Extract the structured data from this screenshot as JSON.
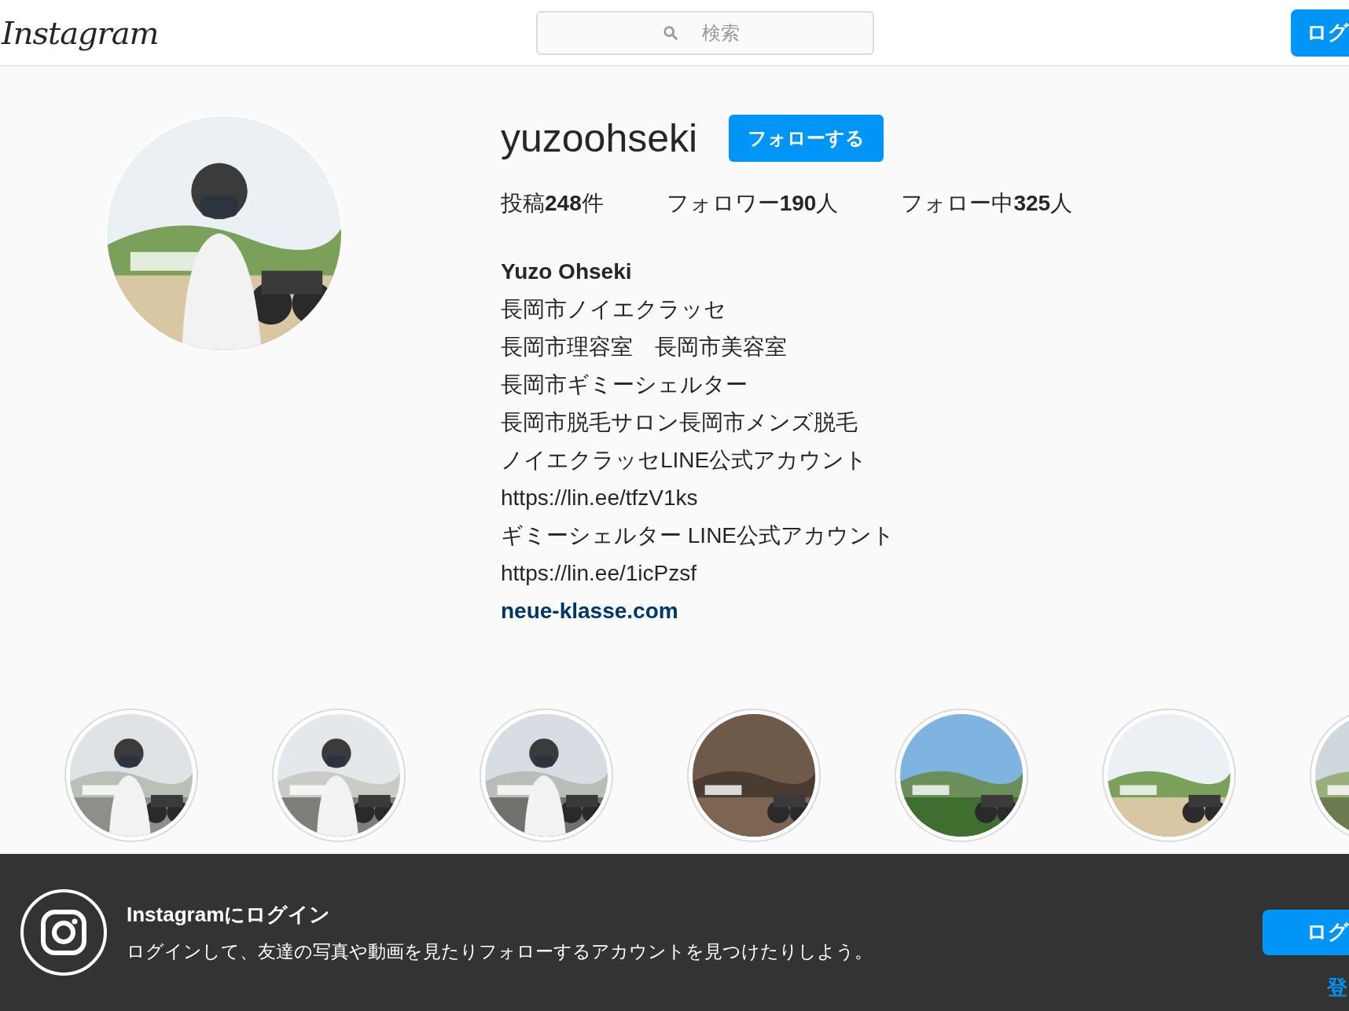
{
  "header": {
    "logo": "Instagram",
    "search": {
      "placeholder": "検索"
    },
    "login_button": "ログ"
  },
  "profile": {
    "username": "yuzoohseki",
    "follow_button": "フォローする",
    "stats": [
      "投稿**248**件",
      "フォロワー**190**人",
      "フォロー中**325**人"
    ],
    "full_name": "Yuzo Ohseki",
    "bio_lines": [
      "長岡市ノイエクラッセ",
      "長岡市理容室　長岡市美容室",
      "長岡市ギミーシェルター",
      "長岡市脱毛サロン長岡市メンズ脱毛",
      "ノイエクラッセLINE公式アカウント",
      "https://lin.ee/tfzV1ks",
      "ギミーシェルター LINE公式アカウント",
      "https://lin.ee/1icPzsf"
    ],
    "website": "neue-klasse.com"
  },
  "login_banner": {
    "title": "Instagramにログイン",
    "message": "ログインして、友達の写真や動画を見たりフォローするアカウントを見つけたりしよう。",
    "login_button": "ログ",
    "signup_link": "登"
  }
}
